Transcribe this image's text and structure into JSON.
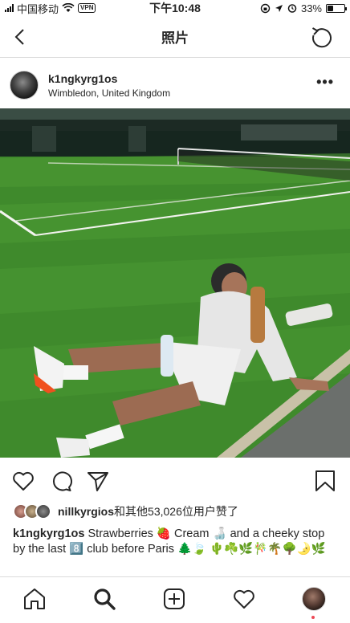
{
  "status_bar": {
    "carrier": "中国移动",
    "vpn": "VPN",
    "time": "下午10:48",
    "battery": "33%",
    "battery_level": 0.33
  },
  "nav": {
    "title": "照片",
    "back_icon": "chevron-left-icon",
    "refresh_icon": "refresh-icon"
  },
  "post": {
    "username": "k1ngkyrg1os",
    "location": "Wimbledon, United Kingdom",
    "more": "•••"
  },
  "actions": {
    "icons": [
      "heart-icon",
      "comment-icon",
      "share-icon",
      "bookmark-icon"
    ]
  },
  "likes": {
    "user": "nillkyrgios",
    "text": "和其他53,026位用户赞了"
  },
  "caption": {
    "user": "k1ngkyrg1os",
    "text": "Strawberries 🍓 Cream 🍶 and a cheeky stop by the last 8️⃣ club before Paris 🌲🍃 🌵☘️🌿🎋🌴🌳🌛🌿"
  },
  "tab_bar": {
    "icons": [
      "home-icon",
      "search-icon",
      "add-post-icon",
      "activity-heart-icon",
      "profile-avatar"
    ]
  },
  "colors": {
    "grass": "#3f8a2c",
    "grass_stripe": "#4c9a34",
    "divider": "#dbdbdb",
    "text": "#262626"
  }
}
